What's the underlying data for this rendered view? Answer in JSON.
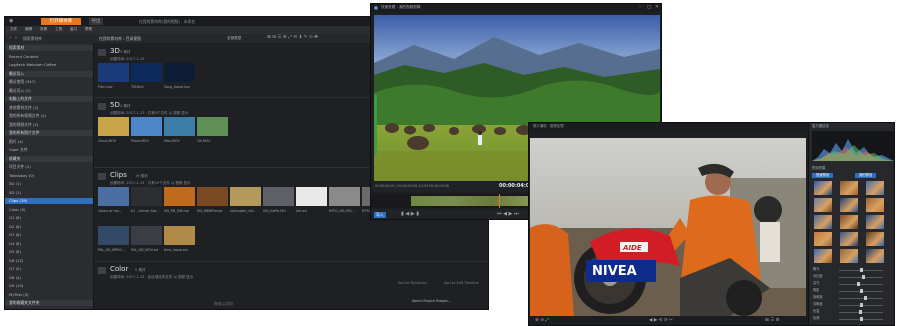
{
  "library": {
    "tab_active": "打开媒体库",
    "tab_second": "导出",
    "title_path": "在我的素材库(我的视频) - 未命名",
    "menu": [
      "文件",
      "编辑",
      "查看",
      "工具",
      "窗口",
      "帮助"
    ],
    "search_placeholder": "搜索素材库",
    "breadcrumb": "在我的素材库 › 目录视图",
    "view_label": "全部类型",
    "sidebar": [
      {
        "label": "搜索素材",
        "type": "group"
      },
      {
        "label": "Recent Content",
        "type": "item"
      },
      {
        "label": "Logitech Webcam Coffee",
        "type": "item"
      },
      {
        "label": "最近导入",
        "type": "group"
      },
      {
        "label": "最近使用 (347)",
        "type": "item"
      },
      {
        "label": "最近导入 (1)",
        "type": "item"
      },
      {
        "label": "电脑上的文件",
        "type": "group"
      },
      {
        "label": "其他素材文件 (2)",
        "type": "item"
      },
      {
        "label": "我的所有视频文件 (2)",
        "type": "item"
      },
      {
        "label": "我的视频文件 (2)",
        "type": "item"
      },
      {
        "label": "我的所有照片文件",
        "type": "group"
      },
      {
        "label": "照片 (4)",
        "type": "item"
      },
      {
        "label": "Viper 文件",
        "type": "item"
      },
      {
        "label": "收藏夹",
        "type": "group"
      },
      {
        "label": "项目文件 (1)",
        "type": "item"
      },
      {
        "label": "TakeAway (0)",
        "type": "item"
      },
      {
        "label": "3D (1)",
        "type": "item"
      },
      {
        "label": "5D (1)",
        "type": "item"
      },
      {
        "label": "Clips (19)",
        "type": "selected"
      },
      {
        "label": "Color (0)",
        "type": "item"
      },
      {
        "label": "G1 (8)",
        "type": "item"
      },
      {
        "label": "G2 (8)",
        "type": "item"
      },
      {
        "label": "G3 (8)",
        "type": "item"
      },
      {
        "label": "G4 (8)",
        "type": "item"
      },
      {
        "label": "G5 (8)",
        "type": "item"
      },
      {
        "label": "G6 (12)",
        "type": "item"
      },
      {
        "label": "G7 (0)",
        "type": "item"
      },
      {
        "label": "G8 (4)",
        "type": "item"
      },
      {
        "label": "G9 (10)",
        "type": "item"
      },
      {
        "label": "MyTest (4)",
        "type": "item"
      },
      {
        "label": "我的收藏夹文件夹",
        "type": "group"
      }
    ],
    "sections": [
      {
        "title": "3D",
        "badge": "3 素材",
        "sub": "创建时间: 2017-1-13",
        "items": [
          {
            "caption": "Fish.mov",
            "color": "#1a3c7a"
          },
          {
            "caption": "TM-Bird",
            "color": "#0d2a5c"
          },
          {
            "caption": "Song_Aquarium",
            "color": "#0e1d36"
          }
        ]
      },
      {
        "title": "5D",
        "badge": "4 素材",
        "sub": "创建时间: 2017-1-13 · 共有5个文件 以 视频 显示",
        "items": [
          {
            "caption": "Cloud.MOV",
            "color": "#c9a44a"
          },
          {
            "caption": "Plane.MOV",
            "color": "#4d86c9"
          },
          {
            "caption": "Man.MOV",
            "color": "#3d7ea8"
          },
          {
            "caption": "OX.MOV",
            "color": "#5f8f56"
          }
        ]
      },
      {
        "title": "Clips",
        "badge": "19 素材",
        "sub": "创建时间: 2017-1-13 · 共有19个文件 以 视频 显示",
        "items": [
          {
            "caption": "Colors of mo...",
            "color": "#4a6fa0"
          },
          {
            "caption": "01 - Lemon Sta...",
            "color": "#2c2e32"
          },
          {
            "caption": "HD_RB_Mill.mo",
            "color": "#c06a1e"
          },
          {
            "caption": "HD_RBWFirmos",
            "color": "#7a4a22"
          },
          {
            "caption": "helicopter_vid...",
            "color": "#b59a5e"
          },
          {
            "caption": "HD_traffic.MO",
            "color": "#5d6066"
          },
          {
            "caption": "ink.avi",
            "color": "#e9e9e9"
          },
          {
            "caption": "NTSC_HD_MO...",
            "color": "#8a8a8a"
          },
          {
            "caption": "NTSC_SD...",
            "color": "#6b6b6b"
          },
          {
            "caption": "PAL_HD_MPEG...",
            "color": "#334a66"
          },
          {
            "caption": "PAL_HD_MOV.avi",
            "color": "#3a3d44"
          },
          {
            "caption": "time_lapse.avi",
            "color": "#b08a46"
          }
        ]
      },
      {
        "title": "Color",
        "badge": "0 素材",
        "sub": "创建时间: 2017-1-13 · 此区域没有文件 以 视频 显示",
        "items": []
      }
    ],
    "bottom_hint": "拖放以添加",
    "right_hints": [
      "Sort to MyLibrary",
      "Sort to Edit Timeline",
      "Save Select a Preset...",
      "Watch Export Images..."
    ]
  },
  "player": {
    "title": "快速查看 - 我的视频剪辑",
    "timecode_left": "01:00:00:00 / 00:00:04:08 1/1:03 00:00:04:08",
    "timecode_center": "00:00:04:04",
    "timecode_right": "01:00:00:00 / 00:00:04:08 1/1 00:00:04:08",
    "mode_left": "导入",
    "mode_right": "导出",
    "status": "缩略图 70%"
  },
  "editor": {
    "title": "照片编辑 - 图像处理",
    "panel_hist": "直方图信息",
    "panel_presets": "预设效果",
    "preset_tab_a": "快速预设",
    "preset_tab_b": "我的预设",
    "sliders": [
      {
        "label": "曝光",
        "value": 0.5
      },
      {
        "label": "对比度",
        "value": 0.55
      },
      {
        "label": "高光",
        "value": 0.45
      },
      {
        "label": "阴影",
        "value": 0.5
      },
      {
        "label": "饱和度",
        "value": 0.6
      },
      {
        "label": "清晰度",
        "value": 0.5
      },
      {
        "label": "色温",
        "value": 0.48
      },
      {
        "label": "色调",
        "value": 0.52
      }
    ],
    "sign_text": "NIVEA",
    "sign_logo": "AIDE"
  },
  "colors": {
    "accent_orange": "#e8781f",
    "selection_blue": "#2f6fc2"
  }
}
